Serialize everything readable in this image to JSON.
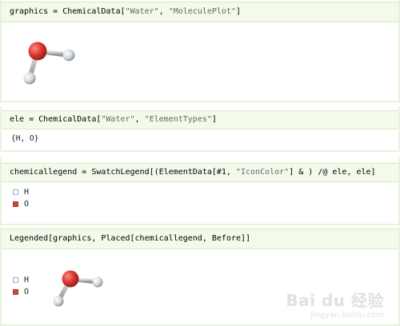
{
  "cells": [
    {
      "input_prefix": "graphics = ChemicalData[",
      "arg1": "\"Water\"",
      "sep": ", ",
      "arg2": "\"MoleculePlot\"",
      "suffix": "]"
    },
    {
      "input_prefix": "ele = ChemicalData[",
      "arg1": "\"Water\"",
      "sep": ", ",
      "arg2": "\"ElementTypes\"",
      "suffix": "]",
      "output": "{H, O}"
    },
    {
      "input_prefix": "chemicallegend = SwatchLegend[(ElementData[#1, ",
      "arg1": "\"IconColor\"",
      "suffix": "] & ) /@ ele, ele]",
      "legend": [
        "H",
        "O"
      ]
    },
    {
      "input": "Legended[graphics, Placed[chemicallegend, Before]]",
      "legend": [
        "H",
        "O"
      ]
    }
  ],
  "colors": {
    "input_bg": "#f3fae9",
    "hydrogen": "#dfe6ea",
    "oxygen": "#d8362f",
    "bond": "#b0b0b0"
  },
  "icons": [
    "water-molecule-icon"
  ],
  "watermark": {
    "main": "Bai du 经验",
    "sub": "jingyan.baidu.com"
  }
}
